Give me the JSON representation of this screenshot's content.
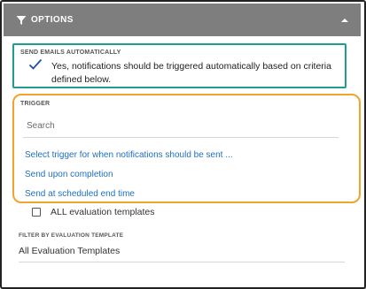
{
  "header": {
    "title": "OPTIONS",
    "icon": "filter-icon",
    "collapse_icon": "chevron-up-icon",
    "background_color": "#7e7e7e"
  },
  "send_emails": {
    "label": "SEND EMAILS AUTOMATICALLY",
    "checked": true,
    "description": "Yes, notifications should be triggered automatically based on criteria defined below.",
    "highlight_color": "#1f9e89"
  },
  "trigger": {
    "label": "TRIGGER",
    "search_placeholder": "Search",
    "options": [
      "Select trigger for when notifications should be sent ...",
      "Send upon completion",
      "Send at scheduled end time"
    ],
    "highlight_color": "#f0a52a",
    "link_color": "#1f6fbf"
  },
  "all_templates": {
    "label": "ALL evaluation templates",
    "checked": false
  },
  "filter_template": {
    "label": "FILTER BY EVALUATION TEMPLATE",
    "value": "All Evaluation Templates"
  }
}
